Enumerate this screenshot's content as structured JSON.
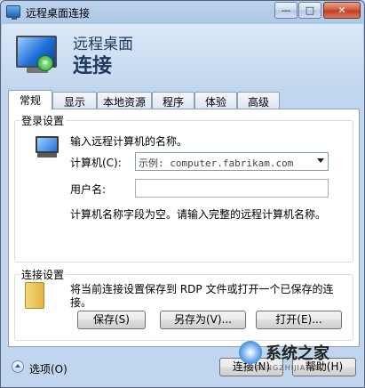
{
  "window": {
    "title": "远程桌面连接",
    "controls": {
      "minimize": "—",
      "maximize": "□",
      "close": "✕"
    }
  },
  "banner": {
    "line1": "远程桌面",
    "line2": "连接"
  },
  "tabs": [
    "常规",
    "显示",
    "本地资源",
    "程序",
    "体验",
    "高级"
  ],
  "active_tab": "常规",
  "login_settings": {
    "group_label": "登录设置",
    "prompt": "输入远程计算机的名称。",
    "computer_label": "计算机(C):",
    "computer_value": "示例: computer.fabrikam.com",
    "username_label": "用户名:",
    "username_value": "",
    "warning": "计算机名称字段为空。请输入完整的远程计算机名称。"
  },
  "connection_settings": {
    "group_label": "连接设置",
    "description_line1": "将当前连接设置保存到 RDP 文件或打开一个已保存的连",
    "description_line2": "接。",
    "save_label": "保存(S)",
    "save_as_label": "另存为(V)...",
    "open_label": "打开(E)..."
  },
  "footer": {
    "options_label": "选项(O)",
    "connect_label": "连接(N)",
    "help_label": "帮助(H)"
  },
  "watermark": {
    "text": "系统之家",
    "sub": "XITONGZHIJIA.NET"
  },
  "icons": [
    "remote-desktop-monitor-icon",
    "connection-arrow-icon",
    "computer-icon",
    "folder-icon",
    "dropdown-arrow-icon",
    "options-chevron-icon"
  ]
}
